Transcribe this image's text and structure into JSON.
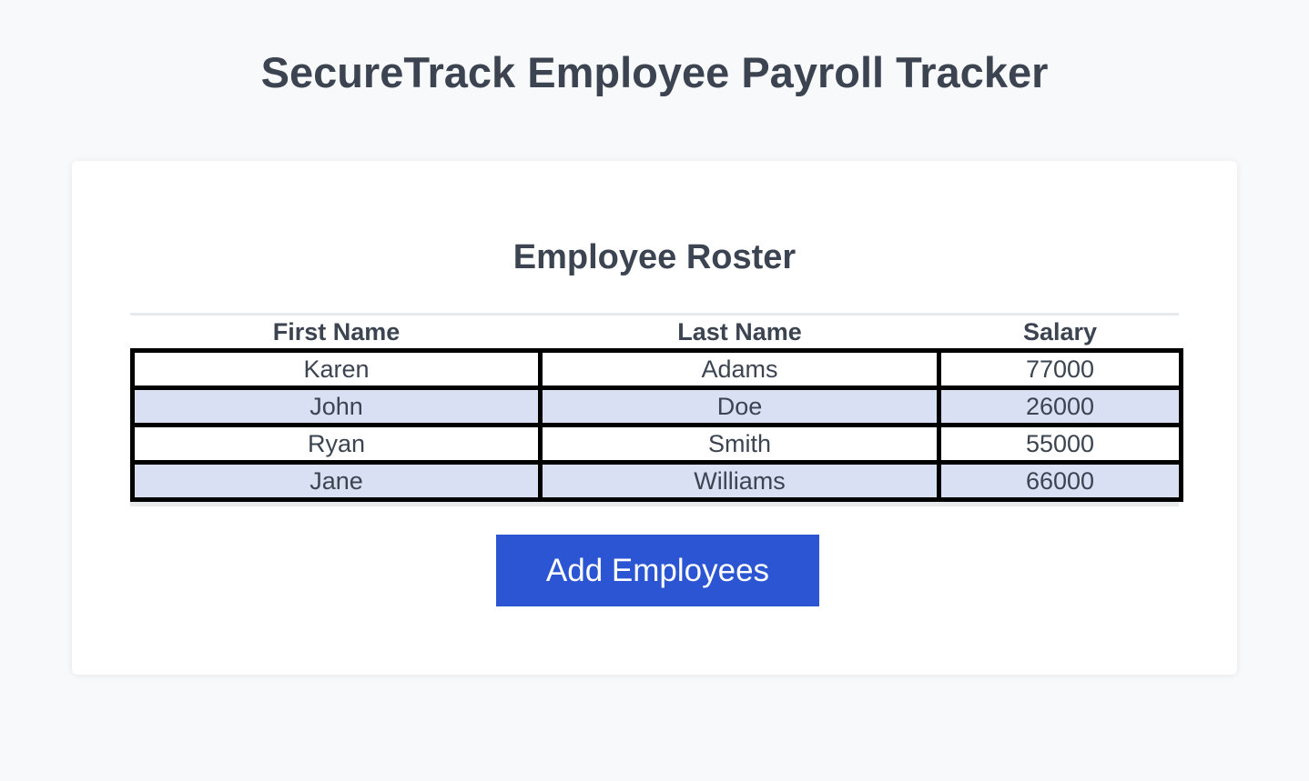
{
  "header": {
    "title": "SecureTrack Employee Payroll Tracker"
  },
  "roster": {
    "title": "Employee Roster",
    "columns": [
      "First Name",
      "Last Name",
      "Salary"
    ],
    "rows": [
      {
        "first_name": "Karen",
        "last_name": "Adams",
        "salary": "77000"
      },
      {
        "first_name": "John",
        "last_name": "Doe",
        "salary": "26000"
      },
      {
        "first_name": "Ryan",
        "last_name": "Smith",
        "salary": "55000"
      },
      {
        "first_name": "Jane",
        "last_name": "Williams",
        "salary": "66000"
      }
    ]
  },
  "actions": {
    "add_label": "Add Employees"
  },
  "colors": {
    "background": "#f8f9fb",
    "text": "#3b4450",
    "row_alt": "#d9e0f4",
    "button": "#2b55d3"
  }
}
